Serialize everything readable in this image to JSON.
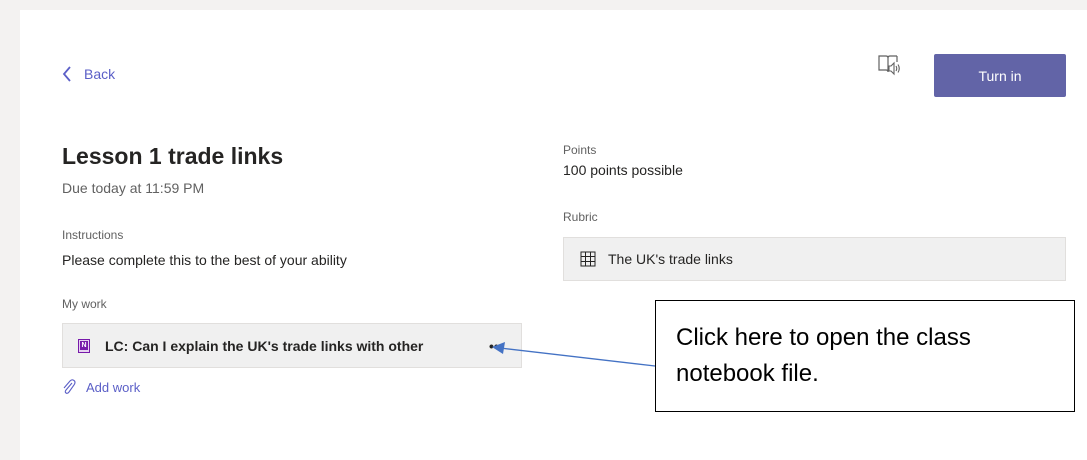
{
  "header": {
    "back_label": "Back",
    "turn_in_label": "Turn in"
  },
  "assignment": {
    "title": "Lesson 1 trade links",
    "due": "Due today at 11:59 PM",
    "instructions_label": "Instructions",
    "instructions_text": "Please complete this to the best of your ability",
    "my_work_label": "My work",
    "file_name": "LC:  Can I explain the UK's trade links with other",
    "add_work_label": "Add work"
  },
  "sidebar": {
    "points_label": "Points",
    "points_value": "100 points possible",
    "rubric_label": "Rubric",
    "rubric_name": "The UK's trade links"
  },
  "annotation": {
    "callout_text": "Click here to open the class notebook file."
  },
  "icons": {
    "back": "chevron-left-icon",
    "reader": "immersive-reader-icon",
    "file": "onenote-icon",
    "more": "more-options-icon",
    "add": "paperclip-icon",
    "rubric": "grid-icon"
  },
  "colors": {
    "accent": "#6264a7",
    "link": "#5b5fc7",
    "onenote": "#7719aa",
    "arrow": "#4472c4"
  }
}
